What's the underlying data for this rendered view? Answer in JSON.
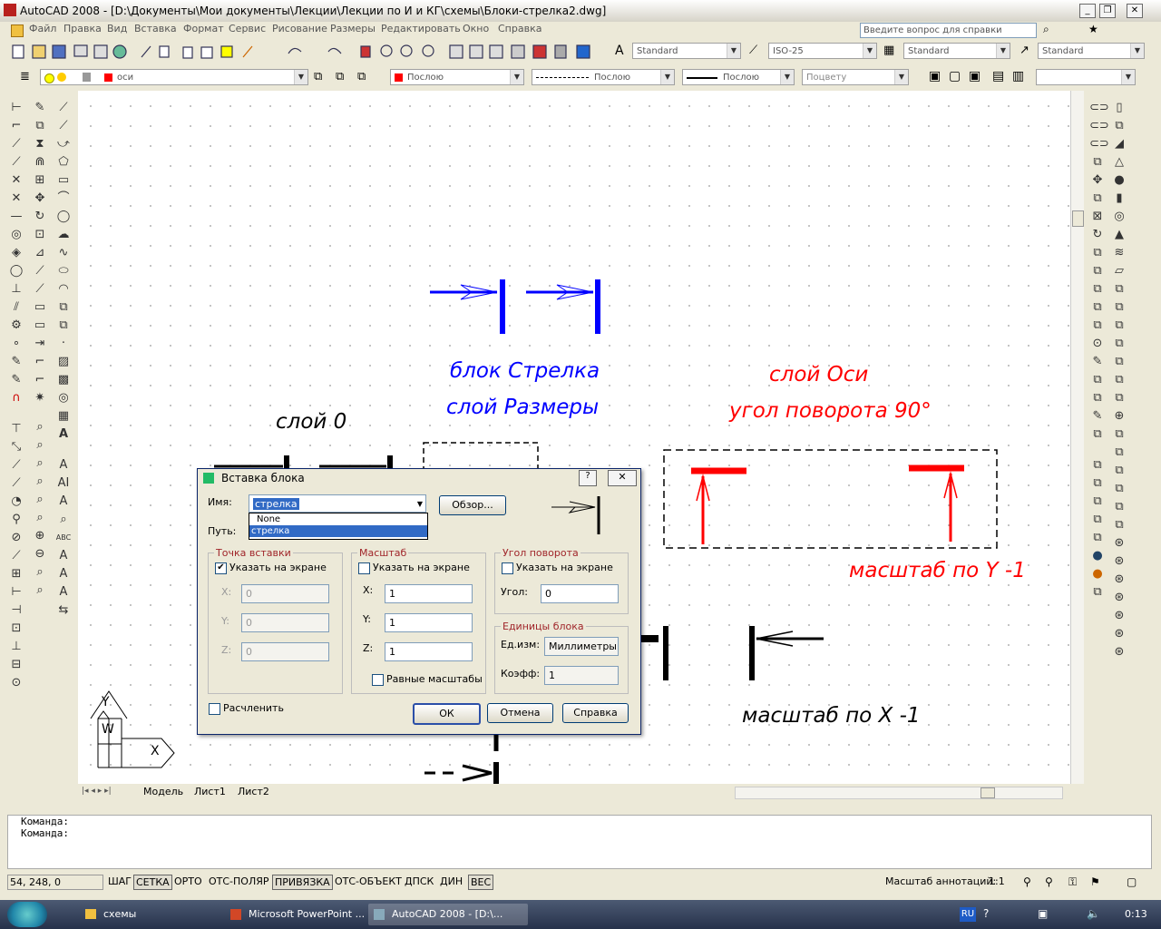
{
  "window": {
    "title": "AutoCAD 2008 - [D:\\Документы\\Мои документы\\Лекции\\Лекции по И и КГ\\схемы\\Блоки-стрелка2.dwg]"
  },
  "menu": [
    "Файл",
    "Правка",
    "Вид",
    "Вставка",
    "Формат",
    "Сервис",
    "Рисование",
    "Размеры",
    "Редактировать",
    "Окно",
    "Справка"
  ],
  "help_search": {
    "placeholder": "Введите вопрос для справки"
  },
  "styles_toolbar": {
    "text_style": "Standard",
    "dim_style": "ISO-25",
    "table_style": "Standard",
    "multileader_style": "Standard"
  },
  "layers_toolbar": {
    "current_layer": "оси"
  },
  "properties_toolbar": {
    "color": "Послою",
    "linetype": "Послою",
    "lineweight": "Послою",
    "plotstyle": "Поцвету"
  },
  "drawing": {
    "text_block_name": "блок Стрелка",
    "text_layer_dims": "слой Размеры",
    "text_layer_0": "слой 0",
    "text_layer_axes": "слой Оси",
    "text_rotation": "угол поворота 90°",
    "text_scale_y": "масштаб по Y -1",
    "text_scale_x": "масштаб по X -1",
    "ucs_x": "X",
    "ucs_y": "Y",
    "ucs_w": "W",
    "colors": {
      "blue": "#0000ff",
      "red": "#ff0000",
      "black": "#000000"
    }
  },
  "layout_tabs": [
    "Модель",
    "Лист1",
    "Лист2"
  ],
  "command_lines": [
    "Команда:",
    "Команда:"
  ],
  "dialog": {
    "title": "Вставка блока",
    "name_label": "Имя:",
    "name_value": "стрелка",
    "dropdown_options": [
      "None",
      "стрелка"
    ],
    "browse_button": "Обзор...",
    "path_label": "Путь:",
    "insertion": {
      "group": "Точка вставки",
      "specify": "Указать на экране",
      "specify_checked": true,
      "x": "0",
      "y": "0",
      "z": "0"
    },
    "scale": {
      "group": "Масштаб",
      "specify": "Указать на экране",
      "specify_checked": false,
      "x": "1",
      "y": "1",
      "z": "1",
      "uniform": "Равные масштабы"
    },
    "rotation": {
      "group": "Угол поворота",
      "specify": "Указать на экране",
      "specify_checked": false,
      "angle_label": "Угол:",
      "angle": "0"
    },
    "units": {
      "group": "Единицы блока",
      "unit_label": "Ед.изм:",
      "unit_value": "Миллиметры",
      "factor_label": "Коэфф:",
      "factor": "1"
    },
    "explode": "Расчленить",
    "ok": "ОК",
    "cancel": "Отмена",
    "help": "Справка",
    "axis_x": "X:",
    "axis_y": "Y:",
    "axis_z": "Z:"
  },
  "status": {
    "coords": "54, 248, 0",
    "buttons": [
      "ШАГ",
      "СЕТКА",
      "ОРТО",
      "ОТС-ПОЛЯР",
      "ПРИВЯЗКА",
      "ОТС-ОБЪЕКТ",
      "ДПСК",
      "ДИН",
      "ВЕС"
    ],
    "annotation_label": "Масштаб аннотаций:",
    "annotation_value": "1:1"
  },
  "taskbar": {
    "items": [
      "схемы",
      "Microsoft PowerPoint ...",
      "AutoCAD 2008 - [D:\\..."
    ],
    "lang": "RU",
    "time": "0:13"
  }
}
